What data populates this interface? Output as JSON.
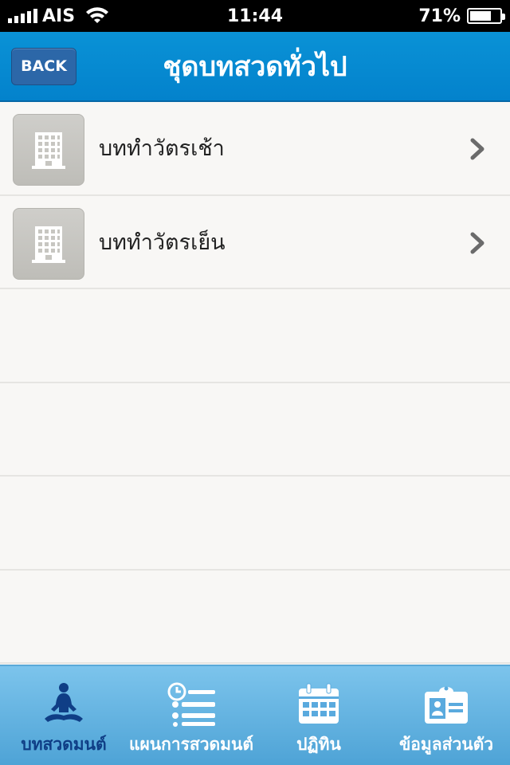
{
  "status_bar": {
    "carrier": "AIS",
    "time": "11:44",
    "battery_percent_label": "71%",
    "battery_level": 0.71
  },
  "nav": {
    "back_label": "BACK",
    "title": "ชุดบทสวดทั่วไป"
  },
  "list": {
    "items": [
      {
        "label": "บททำวัตรเช้า",
        "icon": "building-icon"
      },
      {
        "label": "บททำวัตรเย็น",
        "icon": "building-icon"
      }
    ],
    "empty_rows": 4
  },
  "tab_bar": {
    "active_index": 0,
    "tabs": [
      {
        "label": "บทสวดมนต์",
        "icon": "meditation-icon"
      },
      {
        "label": "แผนการสวดมนต์",
        "icon": "schedule-list-icon"
      },
      {
        "label": "ปฏิทิน",
        "icon": "calendar-icon"
      },
      {
        "label": "ข้อมูลส่วนตัว",
        "icon": "profile-card-icon"
      }
    ]
  },
  "colors": {
    "nav_blue": "#0a92d6",
    "back_button": "#2c67a8",
    "tab_active_text": "#0f3e86",
    "tab_bg": "#6ab8e6"
  }
}
